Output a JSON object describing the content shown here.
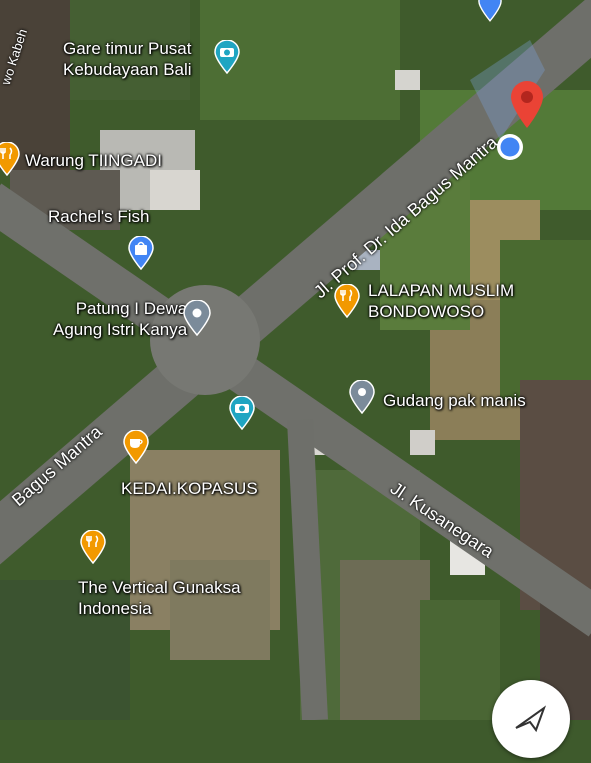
{
  "map": {
    "roads": {
      "main_north": "Jl. Prof. Dr. Ida Bagus Mantra",
      "main_south": "Bagus Mantra",
      "east": "Jl. Kusanegara",
      "west_edge": "wo Kabeh"
    },
    "places": [
      {
        "id": "gare",
        "name_line1": "Gare timur Pusat",
        "name_line2": "Kebudayaan Bali",
        "icon": "camera-icon",
        "color": "#1fa5c2"
      },
      {
        "id": "warung",
        "name_line1": "Warung TIINGADI",
        "icon": "restaurant-icon",
        "color": "#f29900"
      },
      {
        "id": "rachels",
        "name_line1": "Rachel's Fish",
        "icon": "shopping-bag-icon",
        "color": "#4285f4"
      },
      {
        "id": "patung",
        "name_line1": "Patung I Dewa",
        "name_line2": "Agung Istri Kanya",
        "icon": "place-icon",
        "color": "#7b8b9a"
      },
      {
        "id": "lalapan",
        "name_line1": "LALAPAN MUSLIM",
        "name_line2": "BONDOWOSO",
        "icon": "restaurant-icon",
        "color": "#f29900"
      },
      {
        "id": "gudang",
        "name_line1": "Gudang pak manis",
        "icon": "place-icon",
        "color": "#7b8b9a"
      },
      {
        "id": "kedai",
        "name_line1": "KEDAI.KOPASUS",
        "icon": "cafe-icon",
        "color": "#f29900"
      },
      {
        "id": "vertical",
        "name_line1": "The Vertical Gunaksa",
        "name_line2": "Indonesia",
        "icon": "restaurant-icon",
        "color": "#f29900"
      }
    ],
    "destination_pin_color": "#ea4335",
    "current_location_color": "#4285f4"
  }
}
